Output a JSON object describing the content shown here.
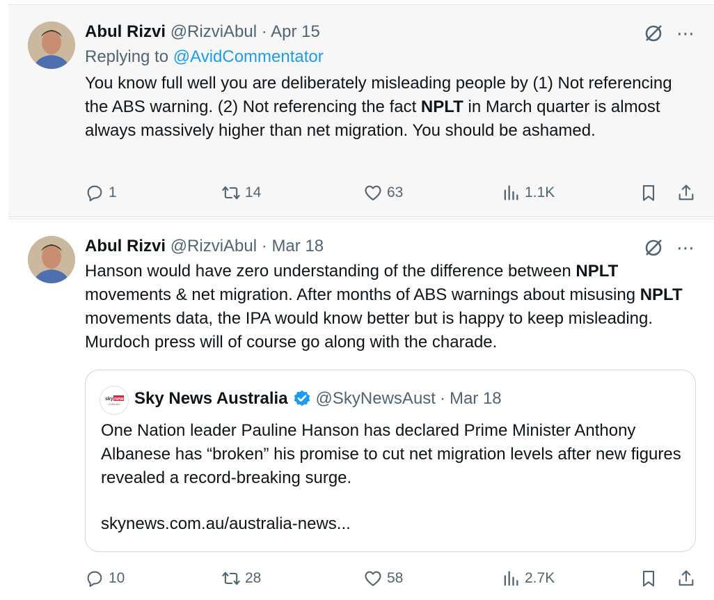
{
  "tweets": [
    {
      "author_name": "Abul Rizvi",
      "handle": "@RizviAbul",
      "separator": "·",
      "date": "Apr 15",
      "replying_prefix": "Replying to ",
      "replying_to": "@AvidCommentator",
      "body": {
        "p1": "You know full well you are deliberately misleading people by (1) Not referencing the ABS warning. (2) Not referencing the fact ",
        "b1": "NPLT",
        "p2": " in March quarter is almost always massively higher than net migration. You should be ashamed."
      },
      "stats": {
        "replies": "1",
        "reposts": "14",
        "likes": "63",
        "views": "1.1K"
      }
    },
    {
      "author_name": "Abul Rizvi",
      "handle": "@RizviAbul",
      "separator": "·",
      "date": "Mar 18",
      "body": {
        "p1": "Hanson would have zero understanding of the difference between ",
        "b1": "NPLT",
        "p2": " movements & net migration. After months of ABS warnings about misusing ",
        "b2": "NPLT",
        "p3": " movements data, the IPA would know better but is happy to keep misleading. Murdoch press will of course go along with the charade."
      },
      "quote": {
        "logo_text_1": "sky",
        "logo_text_2": "news",
        "logo_text_3": ".COM.AU",
        "author_name": "Sky News Australia",
        "handle": "@SkyNewsAust",
        "separator": "·",
        "date": "Mar 18",
        "body": "One Nation leader Pauline Hanson has declared Prime Minister Anthony Albanese has “broken” his promise to cut net migration levels after new figures revealed a record-breaking surge.",
        "link": "skynews.com.au/australia-news..."
      },
      "stats": {
        "replies": "10",
        "reposts": "28",
        "likes": "58",
        "views": "2.7K"
      }
    }
  ],
  "icons": {
    "more": "⋯",
    "grok": "grok-icon",
    "reply": "reply-icon",
    "repost": "repost-icon",
    "like": "like-icon",
    "views": "views-icon",
    "bookmark": "bookmark-icon",
    "share": "share-icon",
    "verified": "verified-badge-icon"
  },
  "colors": {
    "link": "#1d9bf0",
    "secondary_text": "#536471",
    "verified": "#1d9bf0",
    "sky_red": "#d7263d"
  }
}
